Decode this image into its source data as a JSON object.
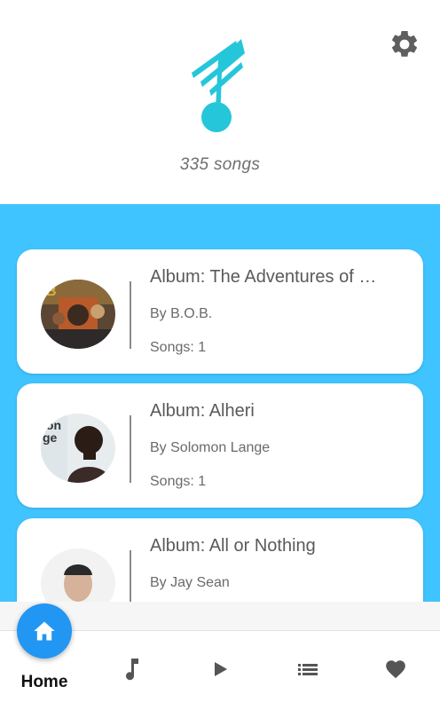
{
  "header": {
    "songs_count": "335 songs",
    "logo_icon": "music-note-icon",
    "settings_icon": "gear-icon"
  },
  "colors": {
    "accent_blue": "#40c4ff",
    "logo_cyan": "#26c6da",
    "fab_blue": "#2196f3"
  },
  "albums": [
    {
      "title": "Album: The Adventures of …",
      "artist": "By B.O.B.",
      "songs": "Songs: 1"
    },
    {
      "title": "Album: Alheri",
      "artist": "By Solomon Lange",
      "songs": "Songs: 1"
    },
    {
      "title": "Album: All or Nothing",
      "artist": "By Jay Sean",
      "songs": ""
    }
  ],
  "nav": {
    "home_label": "Home",
    "items": [
      "home-icon",
      "music-note-icon",
      "play-icon",
      "list-icon",
      "heart-icon"
    ]
  }
}
